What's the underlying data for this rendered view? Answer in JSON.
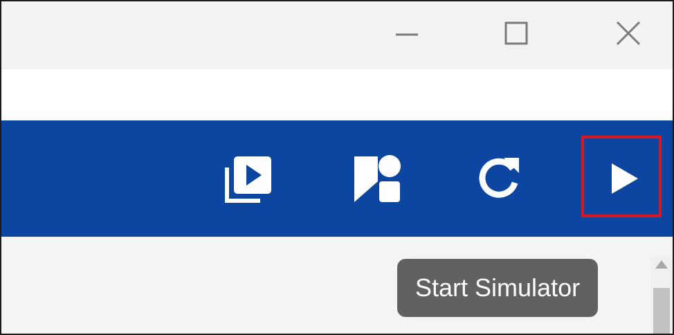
{
  "window_controls": {
    "minimize_icon": "minimize-icon",
    "maximize_icon": "maximize-icon",
    "close_icon": "close-icon"
  },
  "toolbar": {
    "background_color": "#0c46a0",
    "buttons": [
      {
        "id": "video-library",
        "icon": "video-library-icon"
      },
      {
        "id": "shapes",
        "icon": "shapes-icon"
      },
      {
        "id": "refresh",
        "icon": "refresh-icon"
      },
      {
        "id": "start-simulator",
        "icon": "play-icon",
        "highlighted": true
      }
    ],
    "highlight_color": "#e0141e"
  },
  "tooltip": {
    "text": "Start Simulator"
  }
}
